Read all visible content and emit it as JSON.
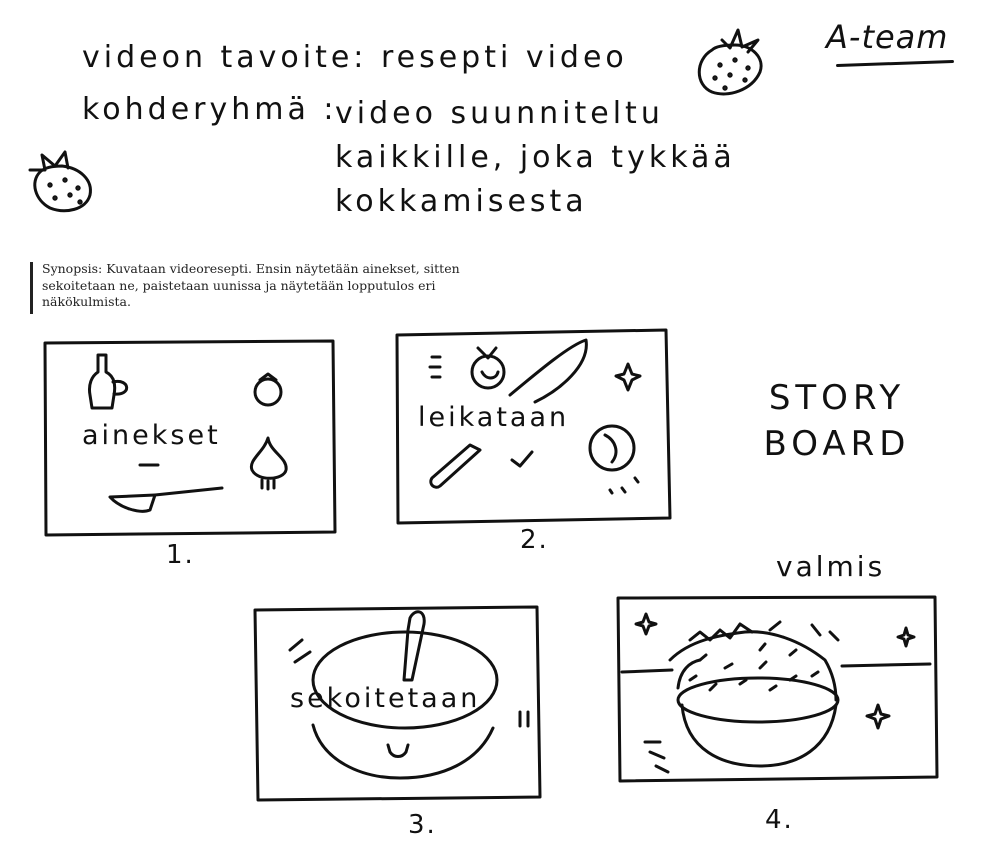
{
  "header": {
    "goal": "videon tavoite: resepti video",
    "target_label": "kohderyhmä :",
    "target_value": "video suunniteltu kaikkille, joka tykkää kokkamisesta",
    "team": "A-team"
  },
  "synopsis": "Synopsis: Kuvataan videoresepti.  Ensin näytetään ainekset, sitten sekoitetaan ne, paistetaan uunissa ja näytetään lopputulos eri näkökulmista.",
  "storyboard_title": "STORY BOARD",
  "frames": [
    {
      "number": "1.",
      "caption": "ainekset"
    },
    {
      "number": "2.",
      "caption": "leikataan"
    },
    {
      "number": "3.",
      "caption": "sekoitetaan"
    },
    {
      "number": "4.",
      "caption": "valmis"
    }
  ],
  "icons": [
    "strawberry-icon",
    "bottle-icon",
    "tomato-icon",
    "onion-icon",
    "knife-icon",
    "sparkle-icon",
    "bowl-icon",
    "spoon-icon"
  ]
}
